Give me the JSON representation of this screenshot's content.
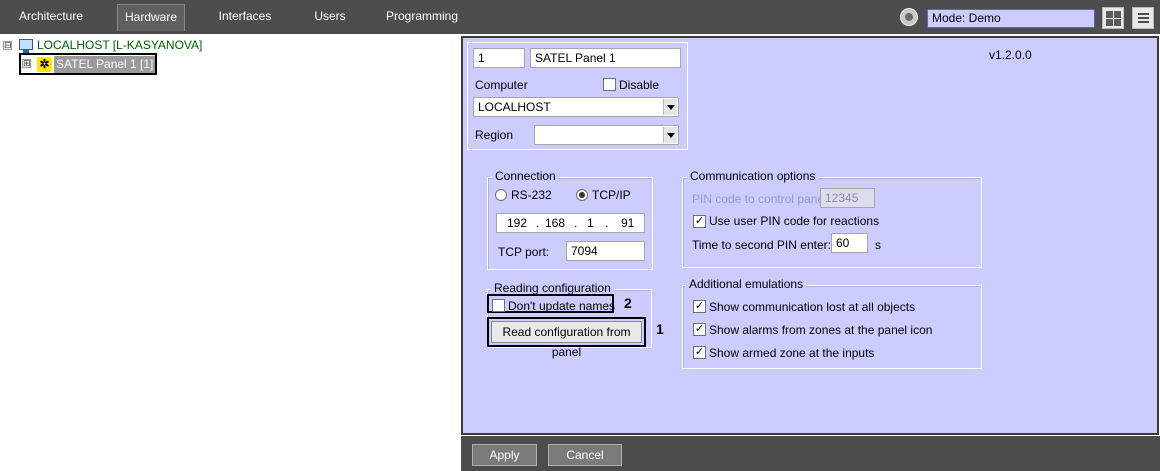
{
  "topbar": {
    "tabs": [
      {
        "label": "Architecture",
        "active": false
      },
      {
        "label": "Hardware",
        "active": true
      },
      {
        "label": "Interfaces",
        "active": false
      },
      {
        "label": "Users",
        "active": false
      },
      {
        "label": "Programming",
        "active": false
      }
    ],
    "mode_value": "Mode: Demo",
    "icons": [
      "mode-gear-icon",
      "layout-grid-icon",
      "menu-list-icon"
    ]
  },
  "tree": {
    "root_label": "LOCALHOST [L-KASYANOVA]",
    "node_label": "SATEL Panel 1 [1]",
    "root_expander": "⊟",
    "node_expander": "⊞"
  },
  "panel": {
    "id_value": "1",
    "name_value": "SATEL Panel 1",
    "computer_label": "Computer",
    "disable_label": "Disable",
    "disable_checked": false,
    "computer_value": "LOCALHOST",
    "region_label": "Region",
    "region_value": "",
    "version": "v1.2.0.0",
    "connection": {
      "title": "Connection",
      "rs232_label": "RS-232",
      "tcpip_label": "TCP/IP",
      "selected": "TCP/IP",
      "ip_octets": [
        "192",
        "168",
        "1",
        "91"
      ],
      "ip_separator": ".",
      "port_label": "TCP port:",
      "port_value": "7094"
    },
    "comm_options": {
      "title": "Communication options",
      "pin_label": "PIN code to control panel:",
      "pin_value": "12345",
      "use_pin_label": "Use user PIN code for reactions",
      "use_pin_checked": true,
      "time_label": "Time to second PIN enter:",
      "time_value": "60",
      "time_unit": "s"
    },
    "reading_config": {
      "title": "Reading configuration",
      "dont_update_label": "Don't update names",
      "dont_update_checked": false,
      "read_button_label": "Read configuration from panel",
      "callout_1": "1",
      "callout_2": "2"
    },
    "additional_emulations": {
      "title": "Additional emulations",
      "items": [
        {
          "label": "Show communication lost at all objects",
          "checked": true
        },
        {
          "label": "Show alarms from zones at the panel icon",
          "checked": true
        },
        {
          "label": "Show armed zone at the inputs",
          "checked": true
        }
      ]
    }
  },
  "footer": {
    "apply_label": "Apply",
    "cancel_label": "Cancel"
  },
  "colors": {
    "panel_bg": "#ccccff",
    "topbar_bg": "#4d4d4d",
    "tree_root_text": "#006000",
    "satel_icon": "#ffe600"
  }
}
